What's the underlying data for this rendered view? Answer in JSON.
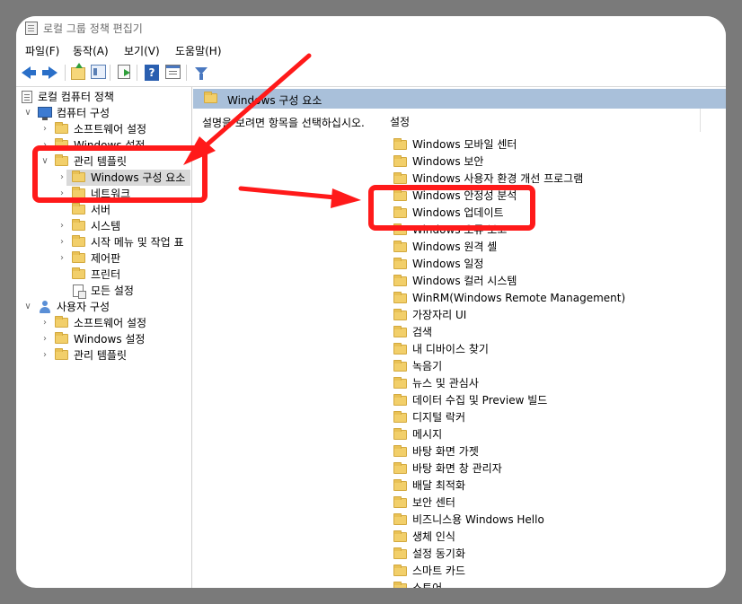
{
  "window": {
    "title": "로컬 그룹 정책 편집기"
  },
  "menu": [
    "파일(F)",
    "동작(A)",
    "보기(V)",
    "도움말(H)"
  ],
  "tree": [
    {
      "label": "로컬 컴퓨터 정책",
      "icon": "policy-icon"
    },
    {
      "label": "컴퓨터 구성",
      "icon": "computer-icon"
    },
    {
      "label": "소프트웨어 설정",
      "icon": "folder-icon"
    },
    {
      "label": "Windows 설정",
      "icon": "folder-icon"
    },
    {
      "label": "관리 템플릿",
      "icon": "folder-icon"
    },
    {
      "label": "Windows 구성 요소",
      "icon": "folder-icon"
    },
    {
      "label": "네트워크",
      "icon": "folder-icon"
    },
    {
      "label": "서버",
      "icon": "folder-icon"
    },
    {
      "label": "시스템",
      "icon": "folder-icon"
    },
    {
      "label": "시작 메뉴 및 작업 표",
      "icon": "folder-icon"
    },
    {
      "label": "제어판",
      "icon": "folder-icon"
    },
    {
      "label": "프린터",
      "icon": "folder-icon"
    },
    {
      "label": "모든 설정",
      "icon": "all-settings-icon"
    },
    {
      "label": "사용자 구성",
      "icon": "user-icon"
    },
    {
      "label": "소프트웨어 설정",
      "icon": "folder-icon"
    },
    {
      "label": "Windows 설정",
      "icon": "folder-icon"
    },
    {
      "label": "관리 템플릿",
      "icon": "folder-icon"
    }
  ],
  "content": {
    "header_title": "Windows 구성 요소",
    "description": "설명을 보려면 항목을 선택하십시오.",
    "column_header": "설정",
    "items": [
      "Windows 모바일 센터",
      "Windows 보안",
      "Windows 사용자 환경 개선 프로그램",
      "Windows 안정성 분석",
      "Windows 업데이트",
      "Windows 오류 보고",
      "Windows 원격 셸",
      "Windows 일정",
      "Windows 컬러 시스템",
      "WinRM(Windows Remote Management)",
      "가장자리 UI",
      "검색",
      "내 디바이스 찾기",
      "녹음기",
      "뉴스 및 관심사",
      "데이터 수집 및 Preview 빌드",
      "디지털 락커",
      "메시지",
      "바탕 화면 가젯",
      "바탕 화면 창 관리자",
      "배달 최적화",
      "보안 센터",
      "비즈니스용 Windows Hello",
      "생체 인식",
      "설정 동기화",
      "스마트 카드",
      "스토어"
    ]
  },
  "colors": {
    "annotation": "#ff1a1a",
    "header_strip": "#a9c0da",
    "selection": "#d9d9d9",
    "folder": "#f2cf6a"
  }
}
